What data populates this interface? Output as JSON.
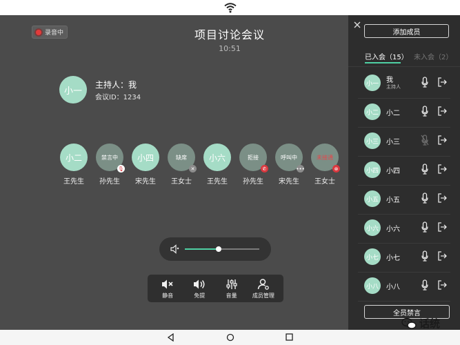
{
  "colors": {
    "accent": "#4fd1a4",
    "avatar": "#a5dcc6",
    "avatar_dim": "#7b8f86",
    "danger": "#d9383f",
    "panel": "#2d2d2d",
    "main": "#4b4b4b"
  },
  "header": {
    "recording_label": "录音中",
    "title": "项目讨论会议",
    "time": "10:51"
  },
  "host": {
    "avatar_text": "小一",
    "label": "主持人：我",
    "meeting_id": "会议ID：1234"
  },
  "participants": [
    {
      "avatar": "小二",
      "status": "",
      "name": "王先生",
      "badge": ""
    },
    {
      "avatar": "",
      "status": "禁言中",
      "name": "孙先生",
      "badge": "mic-off-icon"
    },
    {
      "avatar": "小四",
      "status": "",
      "name": "宋先生",
      "badge": ""
    },
    {
      "avatar": "",
      "status": "缺席",
      "name": "王女士",
      "badge": "close-icon"
    },
    {
      "avatar": "小六",
      "status": "",
      "name": "王先生",
      "badge": ""
    },
    {
      "avatar": "",
      "status": "拒接",
      "name": "孙先生",
      "badge": "call-rejected-icon"
    },
    {
      "avatar": "",
      "status": "呼叫中",
      "name": "宋先生",
      "badge": "more-icon"
    },
    {
      "avatar": "",
      "status": "未接通",
      "name": "王女士",
      "badge": "error-icon"
    }
  ],
  "volume": {
    "level": 0.45,
    "icon": "speaker-icon"
  },
  "toolbar": {
    "mute": "静音",
    "handsfree": "免提",
    "volume": "音量",
    "members": "成员管理"
  },
  "panel": {
    "add_member": "添加成员",
    "tab_joined": "已入会（15）",
    "tab_not_joined": "未入会（2）",
    "mute_all": "全员禁言",
    "members": [
      {
        "avatar": "小一",
        "name": "我",
        "sub": "主持人",
        "mic": "on"
      },
      {
        "avatar": "小二",
        "name": "小二",
        "sub": "",
        "mic": "on"
      },
      {
        "avatar": "小三",
        "name": "小三",
        "sub": "",
        "mic": "off"
      },
      {
        "avatar": "小四",
        "name": "小四",
        "sub": "",
        "mic": "on"
      },
      {
        "avatar": "小五",
        "name": "小五",
        "sub": "",
        "mic": "on"
      },
      {
        "avatar": "小六",
        "name": "小六",
        "sub": "",
        "mic": "on"
      },
      {
        "avatar": "小七",
        "name": "小七",
        "sub": "",
        "mic": "on"
      },
      {
        "avatar": "小八",
        "name": "小八",
        "sub": "",
        "mic": "on"
      }
    ]
  },
  "watermark": {
    "text": "话统"
  }
}
